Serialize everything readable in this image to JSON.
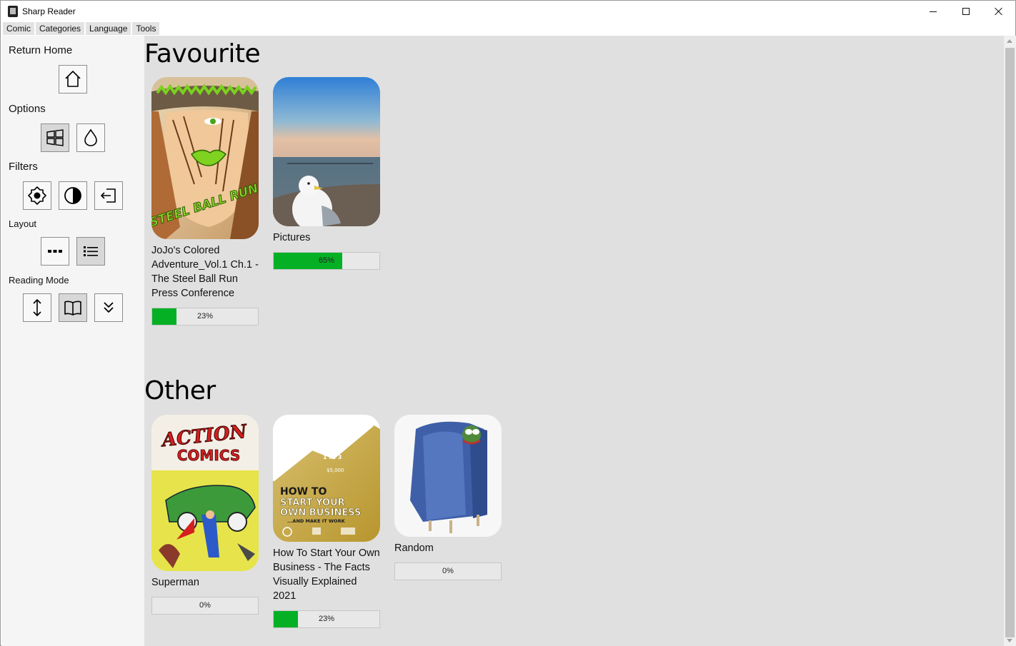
{
  "window": {
    "title": "Sharp Reader"
  },
  "menu": [
    "Comic",
    "Categories",
    "Language",
    "Tools"
  ],
  "sidebar": {
    "return_home": "Return Home",
    "options": "Options",
    "filters": "Filters",
    "layout": "Layout",
    "reading_mode": "Reading Mode"
  },
  "sections": {
    "favourite": {
      "title": "Favourite",
      "items": [
        {
          "title": "JoJo's Colored Adventure_Vol.1 Ch.1 - The Steel Ball Run Press Conference",
          "progress": 23,
          "progress_label": "23%",
          "cover_text": "STEEL BALL RUN"
        },
        {
          "title": "Pictures",
          "progress": 65,
          "progress_label": "65%"
        }
      ]
    },
    "other": {
      "title": "Other",
      "items": [
        {
          "title": "Superman",
          "progress": 0,
          "progress_label": "0%",
          "cover_text": "ACTION COMICS"
        },
        {
          "title": "How To Start Your Own Business - The Facts Visually Explained 2021",
          "progress": 23,
          "progress_label": "23%",
          "cover_text": "HOW TO START YOUR OWN BUSINESS ...AND MAKE IT WORK"
        },
        {
          "title": "Random",
          "progress": 0,
          "progress_label": "0%"
        }
      ]
    }
  },
  "colors": {
    "progress": "#06b025",
    "content_bg": "#e0e0e0",
    "sidebar_bg": "#f5f5f5"
  }
}
